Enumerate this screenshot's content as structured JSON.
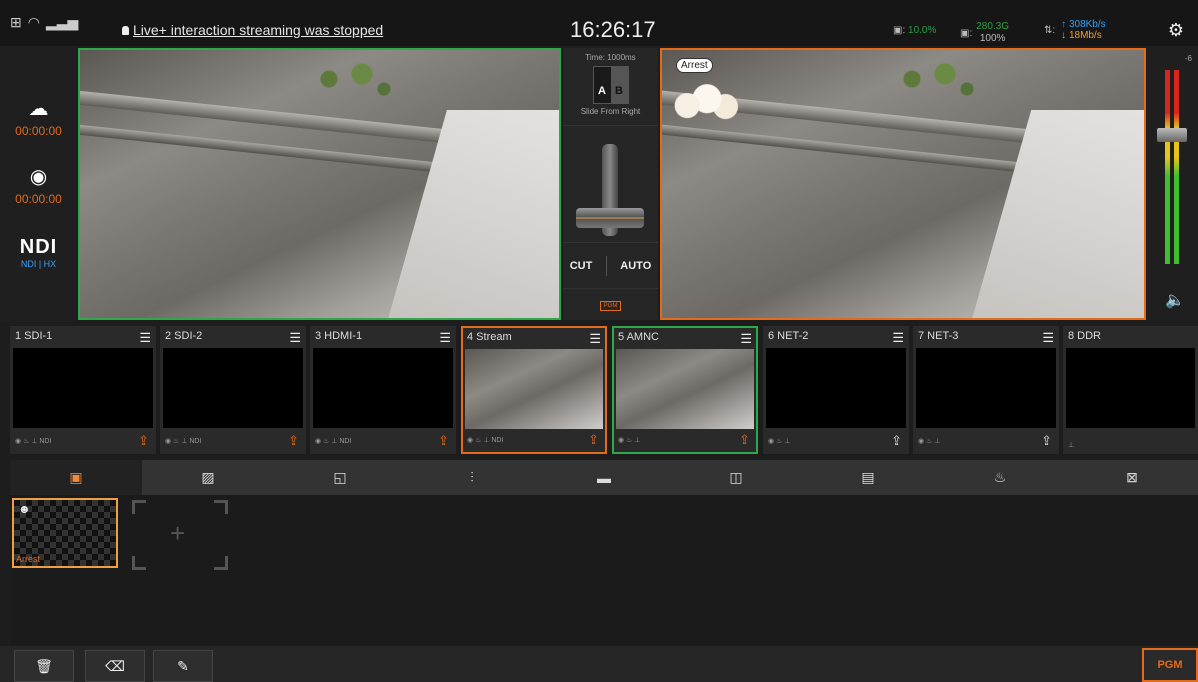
{
  "statusbar": {
    "notice": "Live+ interaction streaming was stopped",
    "clock": "16:26:17",
    "cpu_value": "10.0%",
    "disk_top": "280.3G",
    "disk_bottom": "100%",
    "net_up": "308Kb/s",
    "net_down": "18Mb/s"
  },
  "leftcol": {
    "stream_time": "00:00:00",
    "record_time": "00:00:00",
    "ndi_logo": "NDI",
    "ndi_hx": "NDI | HX"
  },
  "transition": {
    "time": "Time: 1000ms",
    "a": "A",
    "b": "B",
    "effect": "Slide From Right",
    "cut": "CUT",
    "auto": "AUTO",
    "pgm_tag": "PGM"
  },
  "pgm_overlay": {
    "bubble": "Arrest"
  },
  "meter": {
    "top_label": "-6"
  },
  "sources": [
    {
      "label": "1  SDI-1",
      "foot": "◉ ♨ ⊥ NDI"
    },
    {
      "label": "2  SDI-2",
      "foot": "◉ ♨ ⊥ NDI"
    },
    {
      "label": "3  HDMI-1",
      "foot": "◉ ♨ ⊥ NDI"
    },
    {
      "label": "4  Stream",
      "foot": "◉ ♨ ⊥ NDI"
    },
    {
      "label": "5  AMNC",
      "foot": "◉ ♨ ⊥"
    },
    {
      "label": "6  NET-2",
      "foot": "◉ ♨ ⊥"
    },
    {
      "label": "7  NET-3",
      "foot": "◉ ♨ ⊥"
    },
    {
      "label": "8  DDR",
      "foot": "⊥"
    }
  ],
  "tabs": [
    "image-overlay-icon",
    "image-text-icon",
    "picture-in-picture-icon",
    "audio-mixer-icon",
    "folder-icon",
    "timer-icon",
    "notes-icon",
    "live-stream-icon",
    "replace-icon"
  ],
  "content": {
    "thumb_label": "Arrest",
    "add_symbol": "+"
  },
  "bottombar": {
    "pgm": "PGM"
  }
}
